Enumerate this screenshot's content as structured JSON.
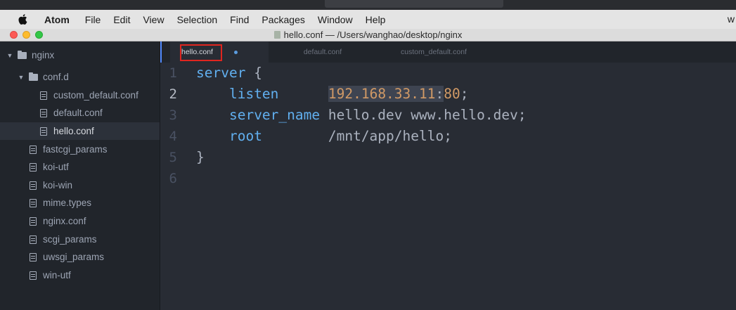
{
  "menubar": {
    "app_name": "Atom",
    "items": [
      "File",
      "Edit",
      "View",
      "Selection",
      "Find",
      "Packages",
      "Window",
      "Help"
    ],
    "right_text": "w"
  },
  "window": {
    "title": "hello.conf — /Users/wanghao/desktop/nginx"
  },
  "sidebar": {
    "items": [
      {
        "label": "nginx",
        "type": "folder",
        "expanded": true,
        "depth": 0
      },
      {
        "label": "conf.d",
        "type": "folder",
        "expanded": true,
        "depth": 1
      },
      {
        "label": "custom_default.conf",
        "type": "file",
        "depth": 2
      },
      {
        "label": "default.conf",
        "type": "file",
        "depth": 2
      },
      {
        "label": "hello.conf",
        "type": "file",
        "depth": 2,
        "selected": true
      },
      {
        "label": "fastcgi_params",
        "type": "file",
        "depth": 1
      },
      {
        "label": "koi-utf",
        "type": "file",
        "depth": 1
      },
      {
        "label": "koi-win",
        "type": "file",
        "depth": 1
      },
      {
        "label": "mime.types",
        "type": "file",
        "depth": 1
      },
      {
        "label": "nginx.conf",
        "type": "file",
        "depth": 1
      },
      {
        "label": "scgi_params",
        "type": "file",
        "depth": 1
      },
      {
        "label": "uwsgi_params",
        "type": "file",
        "depth": 1
      },
      {
        "label": "win-utf",
        "type": "file",
        "depth": 1
      }
    ]
  },
  "tabs": [
    {
      "label": "hello.conf",
      "active": true,
      "modified": true
    },
    {
      "label": "default.conf",
      "active": false
    },
    {
      "label": "custom_default.conf",
      "active": false
    }
  ],
  "editor": {
    "line_numbers": [
      "1",
      "2",
      "3",
      "4",
      "5",
      "6"
    ],
    "current_line": 2,
    "lines": [
      {
        "kw": "server",
        "rest": " {"
      },
      {
        "indent": "    ",
        "kw": "listen",
        "pad": "      ",
        "ip": "192.168.33.11",
        "colon": ":",
        "port": "80",
        "end": ";"
      },
      {
        "indent": "    ",
        "kw": "server_name",
        "value": " hello.dev www.hello.dev;"
      },
      {
        "indent": "    ",
        "kw": "root",
        "value": "        /mnt/app/hello;"
      },
      {
        "text": "}"
      },
      {
        "text": ""
      }
    ]
  },
  "colors": {
    "keyword": "#61afef",
    "number": "#d19a66",
    "text": "#abb2bf",
    "highlight_box": "#e0251f"
  }
}
